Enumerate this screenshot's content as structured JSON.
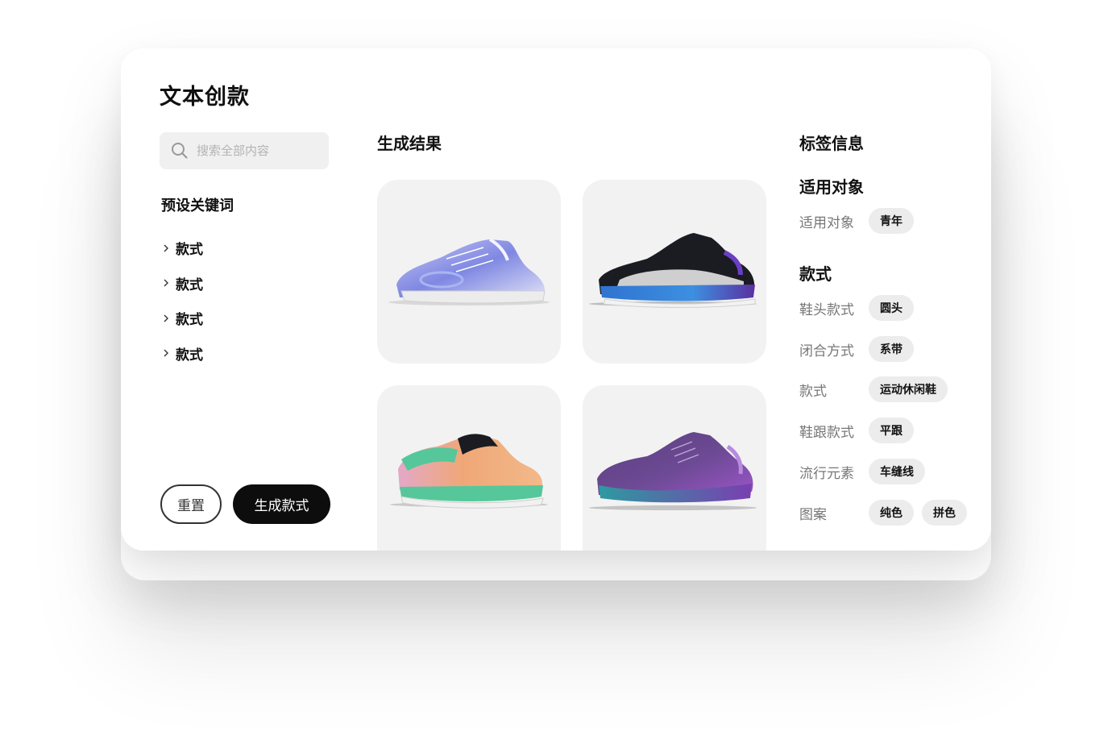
{
  "page_title": "文本创款",
  "search": {
    "placeholder": "搜索全部内容",
    "value": ""
  },
  "preset_keywords": {
    "heading": "预设关键词",
    "items": [
      "款式",
      "款式",
      "款式",
      "款式"
    ]
  },
  "actions": {
    "reset_label": "重置",
    "generate_label": "生成款式"
  },
  "results": {
    "heading": "生成结果",
    "shoes": [
      {
        "icon": "holographic-sneaker-image",
        "colors": [
          "#b9b6f0",
          "#7d86e0",
          "#e9e9f3"
        ]
      },
      {
        "icon": "black-blue-sneaker-image",
        "colors": [
          "#1b1b22",
          "#2f73d0",
          "#5a2fa0"
        ]
      },
      {
        "icon": "pastel-gradient-sneaker-image",
        "colors": [
          "#f0a777",
          "#56c79a",
          "#e3a8c8"
        ]
      },
      {
        "icon": "iridescent-purple-sneaker-image",
        "colors": [
          "#5a3e7c",
          "#2d9aa0",
          "#9a55c6"
        ]
      }
    ]
  },
  "tags": {
    "heading": "标签信息",
    "sections": [
      {
        "heading": "适用对象",
        "rows": [
          {
            "label": "适用对象",
            "chips": [
              "青年"
            ]
          }
        ]
      },
      {
        "heading": "款式",
        "rows": [
          {
            "label": "鞋头款式",
            "chips": [
              "圆头"
            ]
          },
          {
            "label": "闭合方式",
            "chips": [
              "系带"
            ]
          },
          {
            "label": "款式",
            "chips": [
              "运动休闲鞋"
            ]
          },
          {
            "label": "鞋跟款式",
            "chips": [
              "平跟"
            ]
          },
          {
            "label": "流行元素",
            "chips": [
              "车缝线"
            ]
          },
          {
            "label": "图案",
            "chips": [
              "纯色",
              "拼色"
            ]
          }
        ]
      }
    ]
  }
}
